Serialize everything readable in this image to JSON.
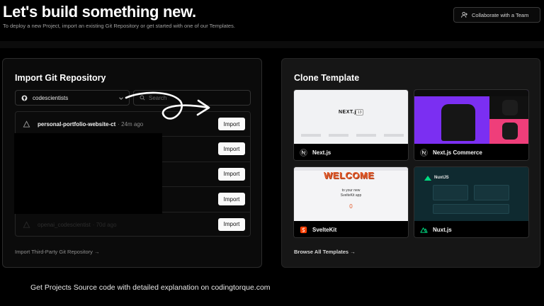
{
  "header": {
    "title": "Let's build something new.",
    "subtitle": "To deploy a new Project, import an existing Git Repository or get started with one of our Templates.",
    "collaborate_label": "Collaborate with a Team"
  },
  "import_card": {
    "title": "Import Git Repository",
    "account_selected": "codescientists",
    "search_placeholder": "Search...",
    "search_placeholder_visible": "Search",
    "repos": [
      {
        "name": "personal-portfolio-website-ct",
        "time": "· 24m ago",
        "import_label": "Import"
      },
      {
        "name": "",
        "time": "",
        "import_label": "Import"
      },
      {
        "name": "",
        "time": "",
        "import_label": "Import"
      },
      {
        "name": "",
        "time": "",
        "import_label": "Import"
      },
      {
        "name": "openai_codescientist",
        "time": "· 70d ago",
        "import_label": "Import"
      }
    ],
    "third_party_link": "Import Third-Party Git Repository →"
  },
  "clone_card": {
    "title": "Clone Template",
    "templates": [
      {
        "name": "Next.js",
        "icon": "nextjs-icon"
      },
      {
        "name": "Next.js Commerce",
        "icon": "nextjs-icon"
      },
      {
        "name": "SvelteKit",
        "icon": "svelte-icon"
      },
      {
        "name": "Nuxt.js",
        "icon": "nuxt-icon"
      }
    ],
    "thumb_text": {
      "nextjs_logo": "NEXT.js",
      "nextjs_version": "13",
      "svelte_welcome": "WELCOME",
      "svelte_line1": "to your new",
      "svelte_line2": "SvelteKit app",
      "svelte_counter": "0",
      "nuxt_logo": "NuxtJS"
    },
    "browse_all_link": "Browse All Templates →"
  },
  "footer_note": "Get Projects Source code with detailed explanation on codingtorque.com",
  "colors": {
    "background": "#000000",
    "card_border": "#2c2c2c",
    "import_button_bg": "#fafafa",
    "commerce_purple": "#7b2ff2",
    "commerce_pink": "#ef3e7a",
    "nuxt_bg": "#0f2a30"
  }
}
